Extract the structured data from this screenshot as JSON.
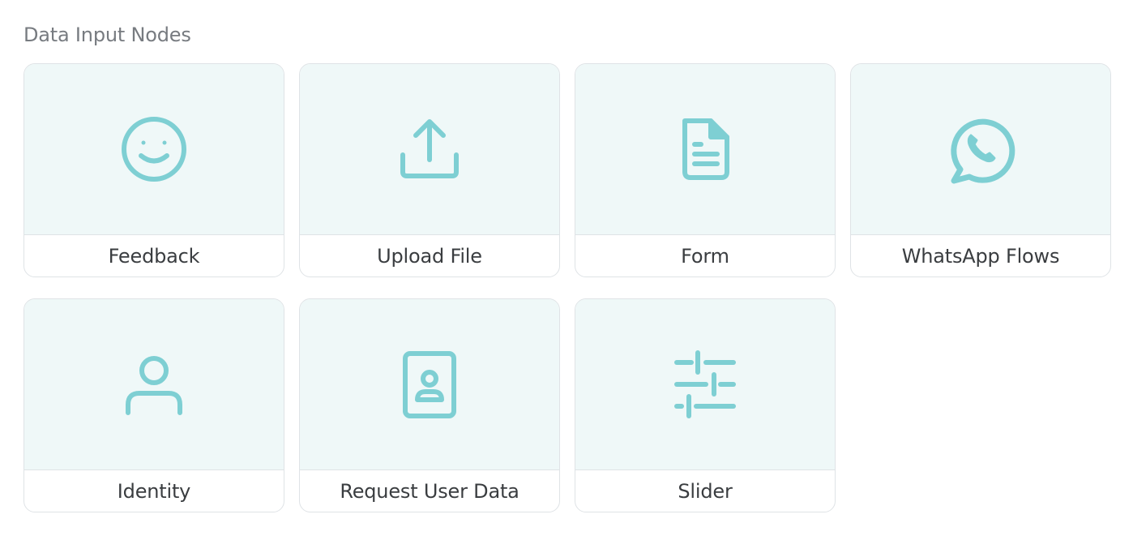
{
  "section": {
    "title": "Data Input Nodes"
  },
  "accent_color": "#7ecfd3",
  "nodes": [
    {
      "label": "Feedback",
      "icon": "smiley-face-icon"
    },
    {
      "label": "Upload File",
      "icon": "upload-icon"
    },
    {
      "label": "Form",
      "icon": "document-icon"
    },
    {
      "label": "WhatsApp Flows",
      "icon": "whatsapp-icon"
    },
    {
      "label": "Identity",
      "icon": "user-icon"
    },
    {
      "label": "Request User Data",
      "icon": "contact-card-icon"
    },
    {
      "label": "Slider",
      "icon": "sliders-icon"
    }
  ]
}
